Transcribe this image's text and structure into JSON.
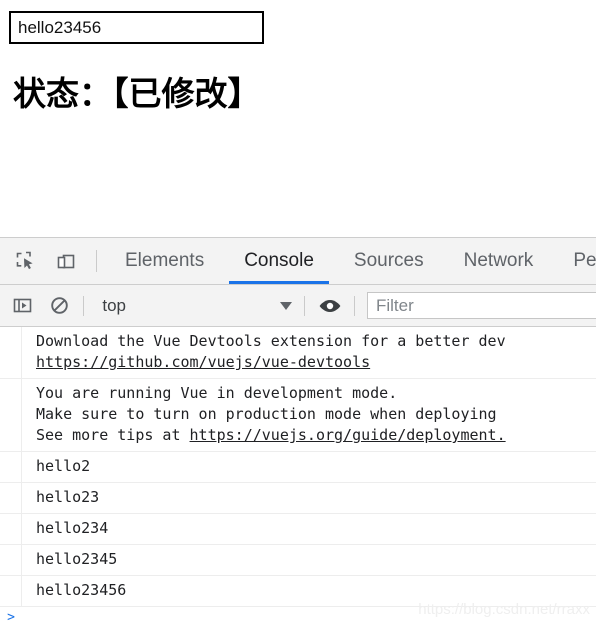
{
  "page": {
    "input_value": "hello23456",
    "input_placeholder": "",
    "status_heading": "状态：【已修改】"
  },
  "devtools": {
    "icons": {
      "inspect": "inspect-element-icon",
      "device_toolbar": "device-toolbar-icon",
      "sidebar_toggle": "console-sidebar-icon",
      "clear_console": "clear-console-icon",
      "eye": "live-expression-eye-icon",
      "caret": "chevron-down-icon"
    },
    "tabs": [
      {
        "label": "Elements",
        "active": false
      },
      {
        "label": "Console",
        "active": true
      },
      {
        "label": "Sources",
        "active": false
      },
      {
        "label": "Network",
        "active": false
      },
      {
        "label": "Pe",
        "active": false
      }
    ],
    "accent_color": "#1a73e8",
    "toolbar_bg": "#f3f3f3",
    "context": {
      "selected": "top"
    },
    "filter": {
      "value": "",
      "placeholder": "Filter"
    },
    "console_messages": [
      {
        "lines": [
          {
            "text": "Download the Vue Devtools extension for a better dev",
            "link": false
          },
          {
            "text": "https://github.com/vuejs/vue-devtools",
            "link": true
          }
        ]
      },
      {
        "lines": [
          {
            "text": "You are running Vue in development mode.",
            "link": false
          },
          {
            "text": "Make sure to turn on production mode when deploying",
            "link": false
          },
          {
            "text": "See more tips at ",
            "link": false,
            "suffix_link": "https://vuejs.org/guide/deployment."
          }
        ]
      },
      {
        "lines": [
          {
            "text": "hello2",
            "link": false
          }
        ]
      },
      {
        "lines": [
          {
            "text": "hello23",
            "link": false
          }
        ]
      },
      {
        "lines": [
          {
            "text": "hello234",
            "link": false
          }
        ]
      },
      {
        "lines": [
          {
            "text": "hello2345",
            "link": false
          }
        ]
      },
      {
        "lines": [
          {
            "text": "hello23456",
            "link": false
          }
        ]
      }
    ],
    "prompt_symbol": ">"
  },
  "watermark": "https://blog.csdn.net/rraxx"
}
